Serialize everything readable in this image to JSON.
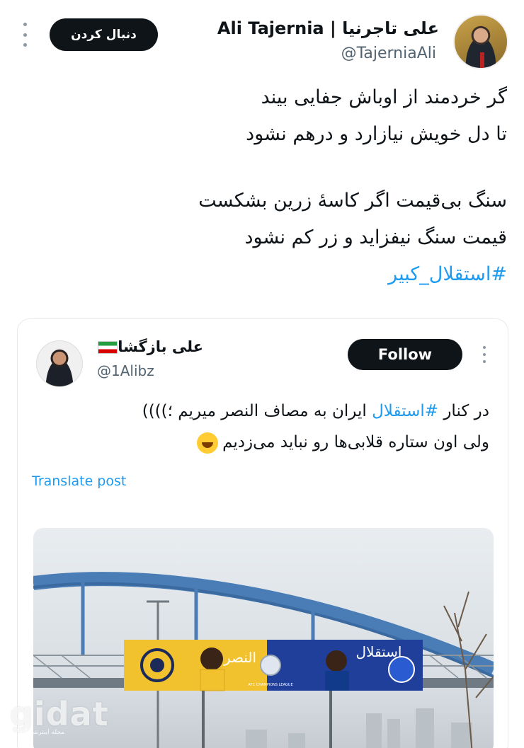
{
  "tweet": {
    "author_name": "Ali Tajernia | علی تاجرنیا",
    "author_handle": "@TajerniaAli",
    "follow_label": "دنبال کردن",
    "poem": [
      "گر خردمند از اوباش جفایی بیند",
      "تا دل خویش نیازارد و درهم نشود",
      "سنگ بی‌قیمت اگر کاسهٔ زرین بشکست",
      "قیمت سنگ نیفزاید و زر کم نشود"
    ],
    "hashtag": "#استقلال_کبیر"
  },
  "quote": {
    "author_name": "علی بازگشا",
    "author_handle": "@1Alibz",
    "follow_label": "Follow",
    "text_part1": "در کنار ",
    "hashtag": "#استقلال",
    "text_part2": " ایران به مصاف النصر میریم ؛))))",
    "text_line2": "ولی اون ستاره قلابی‌ها رو نباید می‌زدیم",
    "translate_label": "Translate post",
    "billboard_right": "استقلال",
    "billboard_left": "النصر",
    "billboard_badge": "AFC CHAMPIONS LEAGUE"
  },
  "watermark": {
    "brand": "gidat",
    "tagline": "مجله اینترنتی گیدات"
  },
  "colors": {
    "accent": "#1d9bf0",
    "button_bg": "#0f1419",
    "secondary_text": "#536471"
  }
}
